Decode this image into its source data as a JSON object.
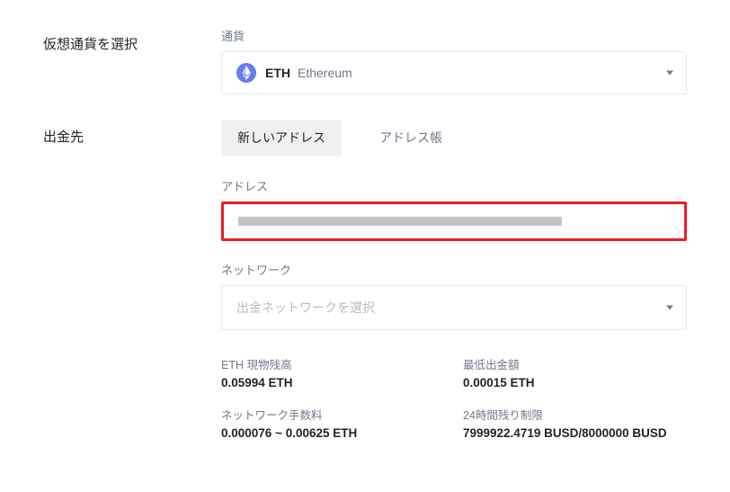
{
  "sections": {
    "select_currency": {
      "label": "仮想通貨を選択"
    },
    "withdraw_to": {
      "label": "出金先"
    }
  },
  "currency": {
    "field_label": "通貨",
    "symbol": "ETH",
    "name": "Ethereum"
  },
  "tabs": {
    "new_address": "新しいアドレス",
    "address_book": "アドレス帳"
  },
  "address": {
    "field_label": "アドレス"
  },
  "network": {
    "field_label": "ネットワーク",
    "placeholder": "出金ネットワークを選択"
  },
  "info": {
    "spot_balance": {
      "label": "ETH 現物残高",
      "value": "0.05994 ETH"
    },
    "min_withdraw": {
      "label": "最低出金額",
      "value": "0.00015 ETH"
    },
    "network_fee": {
      "label": "ネットワーク手数料",
      "value": "0.000076 ~ 0.00625 ETH"
    },
    "limit_24h": {
      "label": "24時間残り制限",
      "value": "7999922.4719 BUSD/8000000 BUSD"
    }
  }
}
